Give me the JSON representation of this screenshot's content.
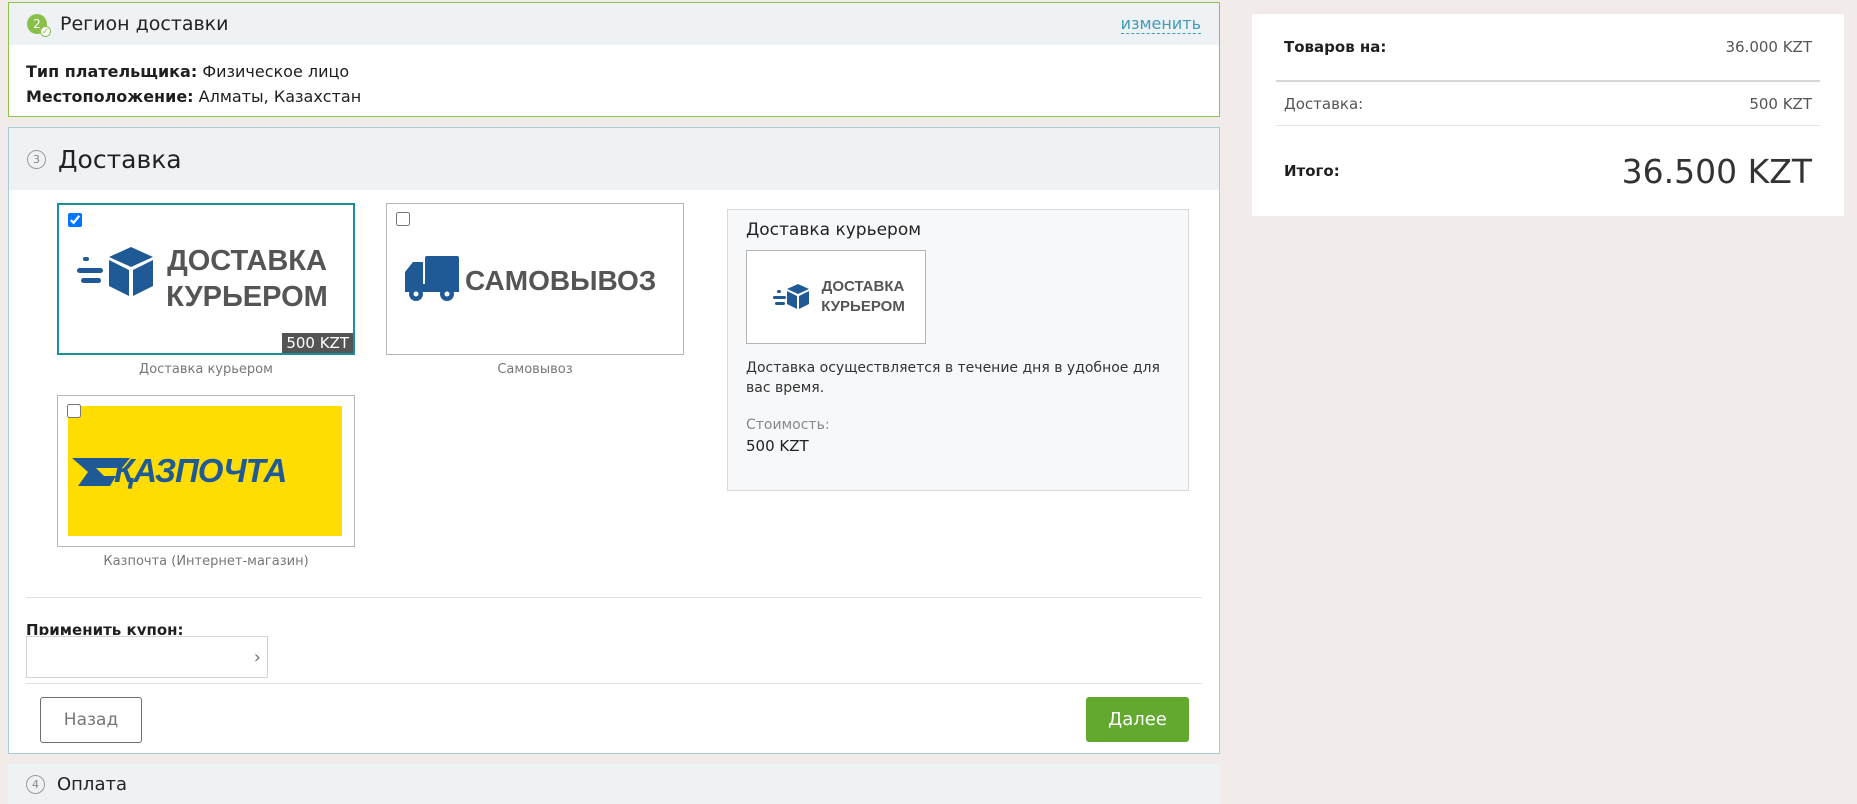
{
  "region": {
    "step": "2",
    "title": "Регион доставки",
    "change_link": "изменить",
    "payer_label": "Тип плательщика:",
    "payer_value": "Физическое лицо",
    "location_label": "Местоположение:",
    "location_value": "Алматы, Казахстан"
  },
  "delivery": {
    "step": "3",
    "title": "Доставка",
    "options": [
      {
        "logo_line1": "ДОСТАВКА",
        "logo_line2": "КУРЬЕРОМ",
        "label": "Доставка курьером",
        "price": "500 KZT",
        "checked": true
      },
      {
        "logo_line1": "САМОВЫВОЗ",
        "label": "Самовывоз",
        "checked": false
      },
      {
        "logo_line1": "ҚАЗПОЧТА",
        "label": "Казпочта (Интернет-магазин)",
        "checked": false
      }
    ],
    "detail": {
      "title": "Доставка курьером",
      "logo_line1": "ДОСТАВКА",
      "logo_line2": "КУРЬЕРОМ",
      "description": "Доставка осуществляется в течение дня в удобное для вас время.",
      "cost_label": "Стоимость:",
      "cost_value": "500 KZT"
    },
    "coupon_label": "Применить купон:",
    "coupon_value": "",
    "back_button": "Назад",
    "next_button": "Далее"
  },
  "payment": {
    "step": "4",
    "title": "Оплата"
  },
  "summary": {
    "goods_label": "Товаров на:",
    "goods_value": "36.000 KZT",
    "delivery_label": "Доставка:",
    "delivery_value": "500 KZT",
    "total_label": "Итого:",
    "total_value": "36.500 KZT"
  },
  "colors": {
    "accent_green": "#63a82f",
    "link_blue": "#3f9bb8",
    "brand_blue": "#1f5a96",
    "kazpost_yellow": "#ffdd00",
    "selected_border": "#1b8e9c"
  }
}
